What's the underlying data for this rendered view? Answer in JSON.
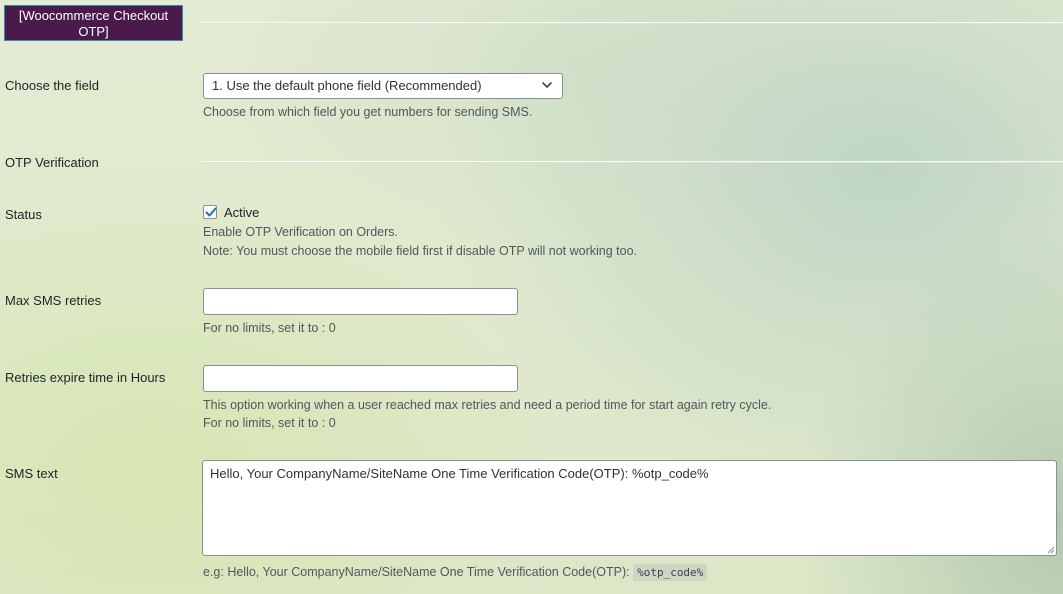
{
  "header": {
    "title": "[Woocommerce Checkout OTP]"
  },
  "choose_field": {
    "label": "Choose the field",
    "selected": "1. Use the default phone field (Recommended)",
    "description": "Choose from which field you get numbers for sending SMS."
  },
  "otp_section": {
    "title": "OTP Verification"
  },
  "status": {
    "label": "Status",
    "checkbox_label": "Active",
    "checked": true,
    "description": "Enable OTP Verification on Orders.",
    "note": "Note: You must choose the mobile field first if disable OTP will not working too."
  },
  "max_retries": {
    "label": "Max SMS retries",
    "value": "",
    "description": "For no limits, set it to : 0"
  },
  "retries_expire": {
    "label": "Retries expire time in Hours",
    "value": "",
    "description": "This option working when a user reached max retries and need a period time for start again retry cycle.",
    "description2": "For no limits, set it to : 0"
  },
  "sms_text": {
    "label": "SMS text",
    "value": "Hello, Your CompanyName/SiteName One Time Verification Code(OTP): %otp_code%",
    "example_prefix": "e.g: Hello, Your CompanyName/SiteName One Time Verification Code(OTP):",
    "example_code": "%otp_code%"
  },
  "icons": {
    "select_arrow": "chevron-down-icon",
    "checkbox": "checkmark-icon",
    "resize": "resize-handle-icon"
  },
  "colors": {
    "header_bg": "#4a1a4d",
    "checkbox_accent": "#2271b1"
  }
}
